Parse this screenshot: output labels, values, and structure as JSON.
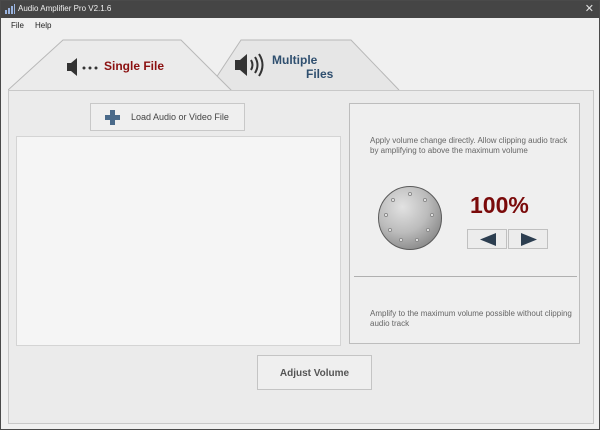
{
  "window": {
    "title": "Audio Amplifier Pro V2.1.6",
    "close_glyph": "✕"
  },
  "menu": [
    "File",
    "Help"
  ],
  "tabs": [
    {
      "label": "Single File",
      "selected": true,
      "color": "#8b1010",
      "icon": "speaker-dots-icon"
    },
    {
      "label_line1": "Multiple",
      "label_line2": "Files",
      "selected": false,
      "color": "#2f4f6f",
      "icon": "speaker-waves-icon"
    }
  ],
  "single_file": {
    "load_button_label": "Load Audio or Video File",
    "load_icon": "plus-icon",
    "description_top": "Apply volume change directly. Allow clipping audio track by amplifying to above the maximum volume",
    "volume_value": "100%",
    "volume_color": "#7a0a0a",
    "description_bottom": "Amplify to the maximum volume possible without clipping audio track",
    "adjust_button_label": "Adjust Volume"
  }
}
